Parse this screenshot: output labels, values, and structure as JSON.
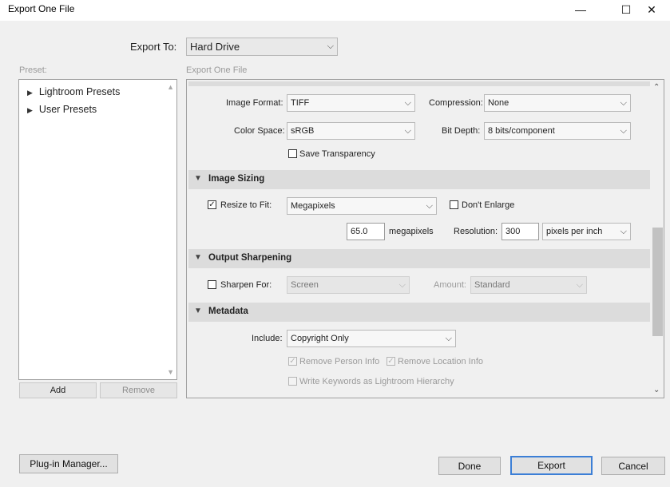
{
  "window": {
    "title": "Export One File",
    "minimize_glyph": "—",
    "maximize_glyph": "☐",
    "close_glyph": "✕"
  },
  "export_to": {
    "label": "Export To:",
    "value": "Hard Drive"
  },
  "preset": {
    "label": "Preset:",
    "items": [
      {
        "label": "Lightroom Presets"
      },
      {
        "label": "User Presets"
      }
    ],
    "add_label": "Add",
    "remove_label": "Remove"
  },
  "panel_label": "Export One File",
  "file_settings": {
    "image_format_label": "Image Format:",
    "image_format_value": "TIFF",
    "compression_label": "Compression:",
    "compression_value": "None",
    "color_space_label": "Color Space:",
    "color_space_value": "sRGB",
    "bit_depth_label": "Bit Depth:",
    "bit_depth_value": "8 bits/component",
    "save_transparency_label": "Save Transparency",
    "save_transparency_checked": false
  },
  "image_sizing": {
    "title": "Image Sizing",
    "resize_label": "Resize to Fit:",
    "resize_checked": true,
    "resize_mode": "Megapixels",
    "dont_enlarge_label": "Don't Enlarge",
    "megapixels_value": "65.0",
    "megapixels_unit": "megapixels",
    "resolution_label": "Resolution:",
    "resolution_value": "300",
    "resolution_unit": "pixels per inch"
  },
  "output_sharpening": {
    "title": "Output Sharpening",
    "sharpen_label": "Sharpen For:",
    "sharpen_value": "Screen",
    "amount_label": "Amount:",
    "amount_value": "Standard"
  },
  "metadata": {
    "title": "Metadata",
    "include_label": "Include:",
    "include_value": "Copyright Only",
    "remove_person_label": "Remove Person Info",
    "remove_location_label": "Remove Location Info",
    "write_keywords_label": "Write Keywords as Lightroom Hierarchy"
  },
  "footer": {
    "plugin_manager_label": "Plug-in Manager...",
    "done_label": "Done",
    "export_label": "Export",
    "cancel_label": "Cancel"
  },
  "colors": {
    "accent": "#3c7fd6",
    "section_bar": "#dcdcdc",
    "background": "#f0f0f0"
  }
}
